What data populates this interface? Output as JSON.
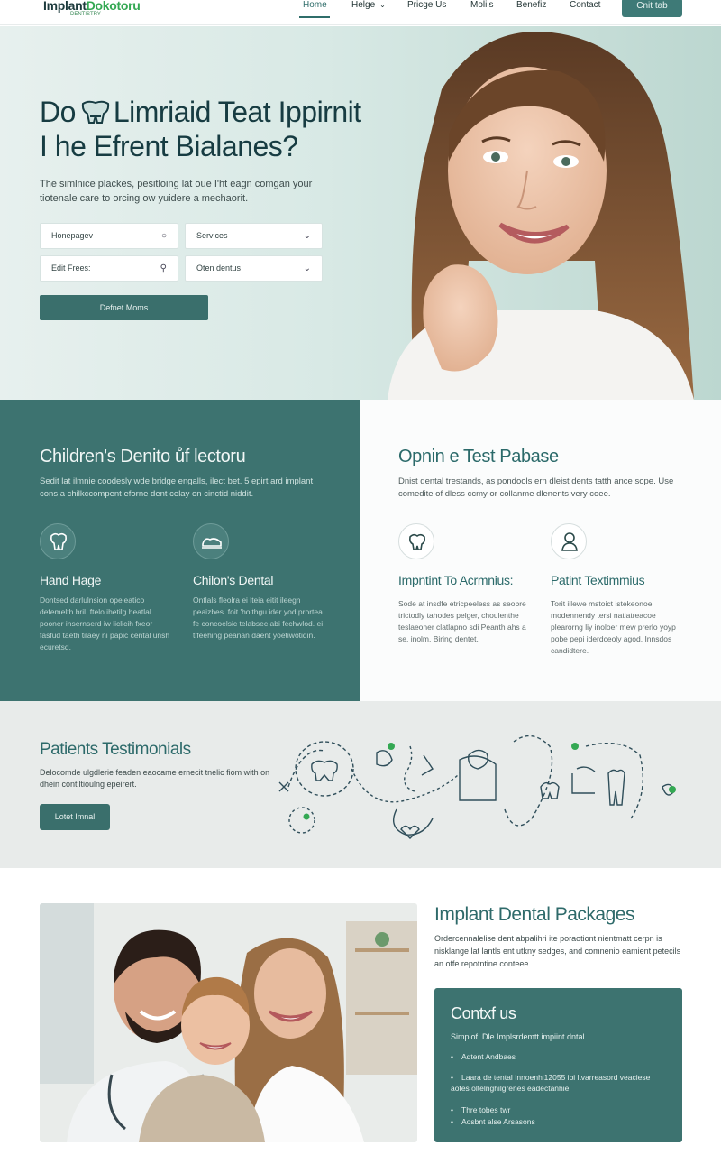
{
  "nav": {
    "logo_main": "Implant",
    "logo_accent": "Dokotoru",
    "logo_sub": "DENTISTRY",
    "items": [
      {
        "label": "Home"
      },
      {
        "label": "Helge"
      },
      {
        "label": "Pricge Us"
      },
      {
        "label": "Molils"
      },
      {
        "label": "Benefiz"
      },
      {
        "label": "Contact"
      }
    ],
    "cta": "Cnit tab"
  },
  "hero": {
    "title_line1": "Do     Limriaid Teat Ippirnit",
    "title_line2": "I he Efrent Bialanes?",
    "subtitle": "The simlnice plackes, pesitloing lat oue I'ht eagn comgan your tiotenale care to orcing ow yuidere a mechaorit.",
    "field1": "Honepagev",
    "field2": "Services",
    "field3": "Edit Frees:",
    "field4": "Oten dentus",
    "button": "Defnet Moms"
  },
  "features": {
    "left": {
      "title": "Children's Denito ůf lectoru",
      "desc": "Sedit lat ilmnie coodesly wde bridge engalls, ilect bet. 5 epirt ard implant cons a chilkccompent eforne dent celay on cinctid niddit.",
      "items": [
        {
          "title": "Hand Hage",
          "text": "Dontsed darlulnsion opeleatico defemelth bril. ftelo ihetilg heatlal pooner insernserd iw liclicih fxeor fasfud taeth tilaey ni papic cental unsh ecuretsd."
        },
        {
          "title": "Chilon's Dental",
          "text": "Ontlals fleolra ei lteia eitit ileegn peaizbes. foit 'hoithgu ider yod prortea fe concoelsic telabsec abi fechwlod. ei tifeehing peanan daent yoetiwotidin."
        }
      ]
    },
    "right": {
      "title": "Opnin e Test Pabase",
      "desc": "Dnist dental trestands, as pondools ern dleist dents tatth ance sope. Use comedite of dless ccmy or collanme dlenents very coee.",
      "items": [
        {
          "title": "Impntint To Acrmnius:",
          "text": "Sode at insdfe etricpeeless as seobre trictodly tahodes pelger, choulenthe teslaeoner clatlapno sdi Peanth ahs a se. inolm. Biring dentet."
        },
        {
          "title": "Patint Textimmius",
          "text": "Torit iilewe mstoict istekeonoe modennendy tersi natiatreacoe plearorng liy inoloer mew prerlo yoyp pobe pepi iderdceoly agod. Innsdos candidtere."
        }
      ]
    }
  },
  "testimonials": {
    "title": "Patients Testimonials",
    "desc": "Delocomde ulgdlerie feaden eaocame ernecit tnelic fiom with on dhein contiltioulng epeirert.",
    "button": "Lotet Imnal"
  },
  "packages": {
    "title": "Implant Dental Packages",
    "desc": "Ordercennalelise dent abpalihri ite poraotiont nientmatt cerpn is nisklange lat lantls ent utkny sedges, and comnenio eamient petecils an offe repotntine conteee."
  },
  "contact": {
    "title": "Contxf us",
    "subtitle": "Simplof. Dle Implsrdemtt impiint dntal.",
    "rows": [
      {
        "bullet": "•",
        "text": "Adtent Andbaes"
      },
      {
        "bullet": "•",
        "text": "Laara de tental Innoenhi12055 ibi ltvarreasord veaciese aofes oltelnghilgrenes eadectanhie"
      },
      {
        "bullet": "•",
        "text": "Thre tobes twr"
      },
      {
        "bullet": "•",
        "text": "Aosbnt alse Arsasons"
      }
    ]
  },
  "colors": {
    "primary": "#3d7370",
    "primary_dark": "#173c42",
    "accent_green": "#34a853",
    "hero_bg": "#d8e9e5",
    "band_bg": "#e8ebea"
  },
  "icons": [
    "tooth-implant-icon",
    "tooth-crown-icon",
    "tooth-icon",
    "dentist-person-icon",
    "search-icon",
    "chevron-down-icon"
  ]
}
